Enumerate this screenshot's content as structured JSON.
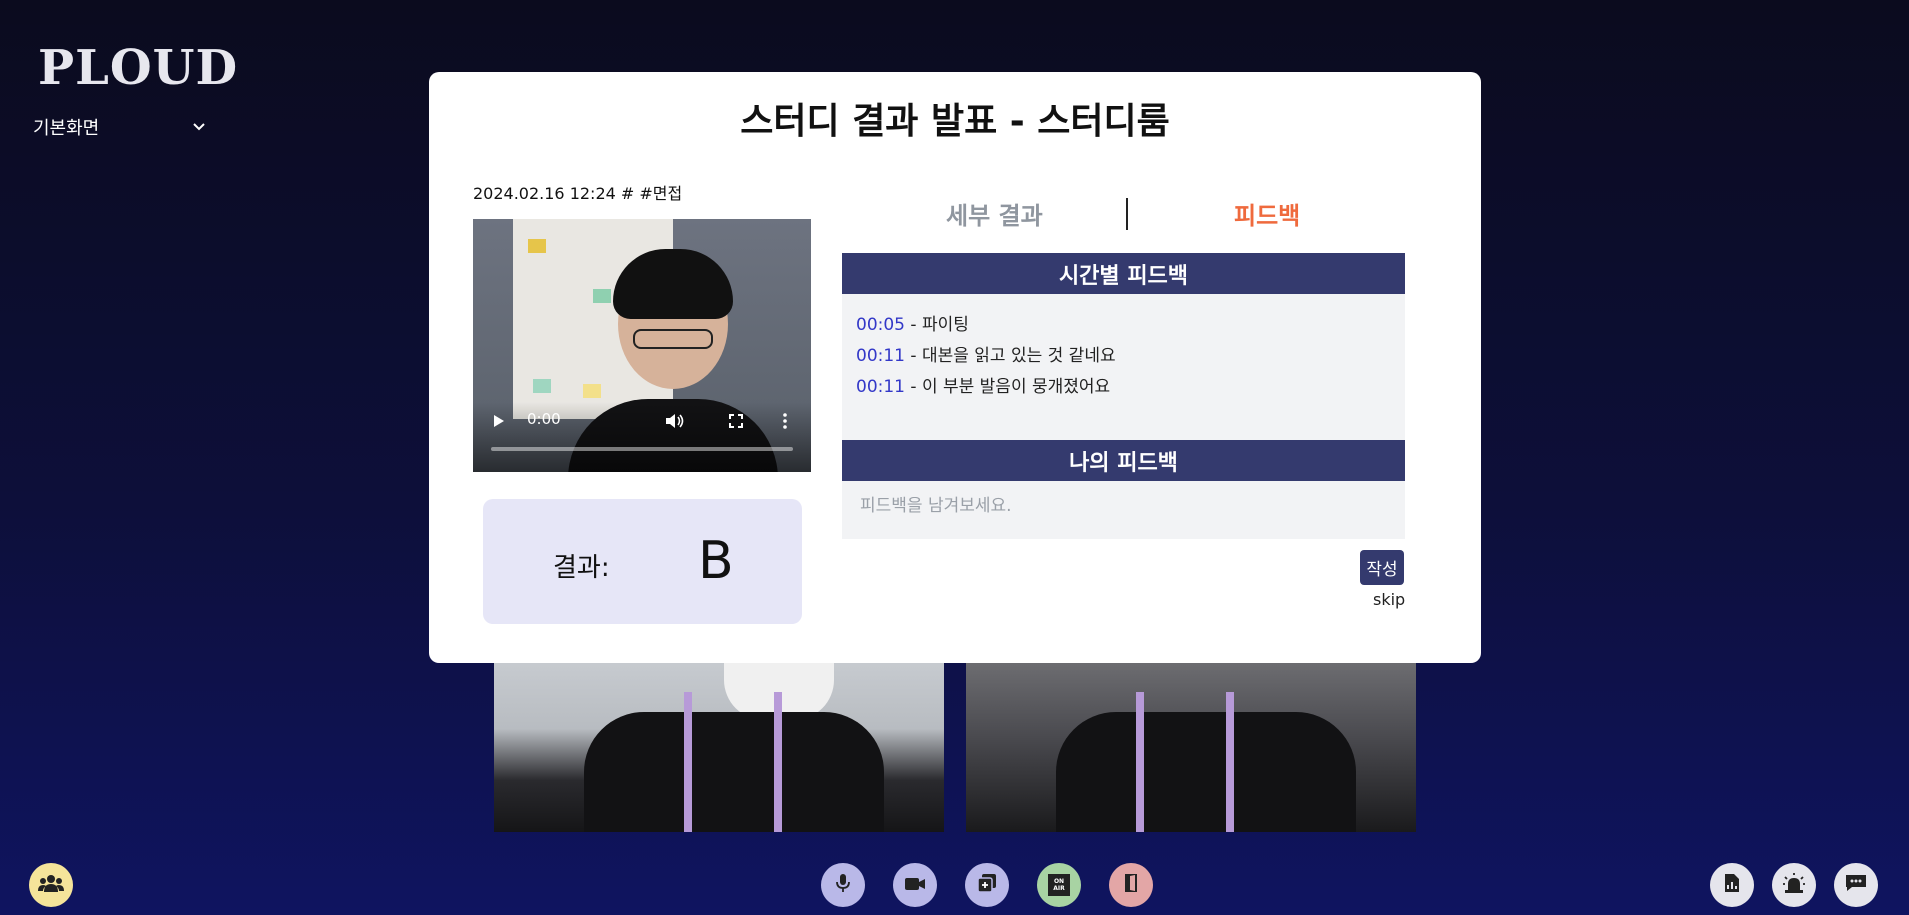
{
  "app": {
    "logo": "PLOUD"
  },
  "view_select": {
    "value": "기본화면"
  },
  "modal": {
    "title": "스터디 결과 발표 - 스터디룸",
    "meta": "2024.02.16 12:24 # #면접",
    "video": {
      "time": "0:00",
      "progress": 0
    },
    "result": {
      "label": "결과:",
      "grade": "B"
    },
    "tabs": [
      {
        "label": "세부 결과",
        "active": false
      },
      {
        "label": "피드백",
        "active": true
      }
    ],
    "timed_feedback": {
      "title": "시간별 피드백",
      "items": [
        {
          "time": "00:05",
          "text": " - 파이팅"
        },
        {
          "time": "00:11",
          "text": " - 대본을 읽고 있는 것 같네요"
        },
        {
          "time": "00:11",
          "text": " - 이 부분 발음이 뭉개졌어요"
        }
      ]
    },
    "my_feedback": {
      "title": "나의 피드백",
      "placeholder": "피드백을 남겨보세요.",
      "value": ""
    },
    "write_label": "작성",
    "skip_label": "skip"
  },
  "toolbar": {
    "onair_label": "ON AIR"
  },
  "colors": {
    "accent": "#343a6e",
    "active_tab": "#ef6a3d",
    "timestamp": "#3338c8",
    "result_bg": "#e6e6f7"
  },
  "icons": [
    "people-icon",
    "mic-icon",
    "camera-icon",
    "share-screen-icon",
    "on-air-icon",
    "exit-door-icon",
    "report-icon",
    "alarm-icon",
    "chat-icon"
  ]
}
